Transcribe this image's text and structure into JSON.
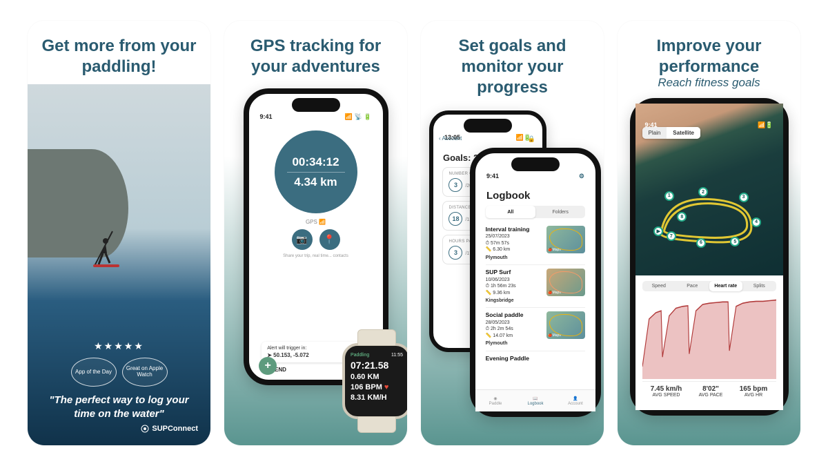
{
  "panel1": {
    "headline": "Get more from your paddling!",
    "stars": "★★★★★",
    "badge1": "App of the Day",
    "badge2": "Great on Apple Watch",
    "quote": "\"The perfect way to log your time on the water\"",
    "attribution": "SUPConnect"
  },
  "panel2": {
    "headline": "GPS tracking for your adventures",
    "status_time": "9:41",
    "status_right": "📶 📡 🔋",
    "timer": "00:34:12",
    "distance": "4.34 km",
    "gps_label": "GPS 📶",
    "share_hint": "Share your trip, real time... contacts",
    "alert_label": "Alert will trigger in:",
    "alert_coords": "➤ 50.153, -5.072",
    "extend": "EXTEND",
    "watch": {
      "activity": "Paddling",
      "clock": "11:55",
      "elapsed": "07:21.58",
      "dist": "0.60 KM",
      "hr": "106 BPM",
      "speed": "8.31 KM/H"
    }
  },
  "panel3": {
    "headline": "Set goals and monitor your progress",
    "goals": {
      "status_time": "13:05",
      "back": "‹ Account",
      "title": "Goals: 2024",
      "cards": [
        {
          "label": "NUMBER OF SESSIONS",
          "value": "3",
          "target": "/200"
        },
        {
          "label": "DISTANCE PADDLED",
          "value": "18",
          "target": "/1,000 KM"
        },
        {
          "label": "HOURS PADDLED",
          "value": "3",
          "target": "/175 HRS"
        }
      ]
    },
    "logbook": {
      "status_time": "9:41",
      "title": "Logbook",
      "tabs": [
        "All",
        "Folders"
      ],
      "items": [
        {
          "title": "Interval training",
          "date": "25/07/2023",
          "dur": "57m 57s",
          "dist": "6.30 km",
          "loc": "Plymouth",
          "map": "Maps"
        },
        {
          "title": "SUP Surf",
          "date": "10/06/2023",
          "dur": "1h 56m 23s",
          "dist": "9.36 km",
          "loc": "Kingsbridge",
          "map": "Maps"
        },
        {
          "title": "Social paddle",
          "date": "28/05/2023",
          "dur": "2h 2m 54s",
          "dist": "14.07 km",
          "loc": "Plymouth",
          "map": "Maps"
        },
        {
          "title": "Evening Paddle",
          "date": "",
          "dur": "",
          "dist": "",
          "loc": "",
          "map": ""
        }
      ],
      "nav": [
        "Paddle",
        "Logbook",
        "Account"
      ]
    }
  },
  "panel4": {
    "headline": "Improve your performance",
    "subhead": "Reach fitness goals",
    "status_time": "9:41",
    "map_modes": [
      "Plain",
      "Satellite"
    ],
    "waypoints": [
      "1",
      "2",
      "3",
      "4",
      "5",
      "6",
      "7",
      "8"
    ],
    "chart_tabs": [
      "Speed",
      "Pace",
      "Heart rate",
      "Splits"
    ],
    "stats": [
      {
        "v": "7.45 km/h",
        "l": "AVG SPEED"
      },
      {
        "v": "8'02\"",
        "l": "AVG PACE"
      },
      {
        "v": "165 bpm",
        "l": "AVG HR"
      }
    ]
  },
  "chart_data": {
    "type": "line",
    "title": "Heart rate",
    "ylabel": "bpm",
    "ylim": [
      60,
      190
    ],
    "x": [
      0,
      0.05,
      0.1,
      0.14,
      0.15,
      0.2,
      0.25,
      0.3,
      0.34,
      0.35,
      0.4,
      0.45,
      0.5,
      0.55,
      0.6,
      0.64,
      0.65,
      0.7,
      0.75,
      0.8,
      0.85,
      0.9,
      0.95,
      1.0
    ],
    "values": [
      80,
      155,
      165,
      168,
      95,
      160,
      172,
      175,
      176,
      100,
      168,
      178,
      180,
      181,
      182,
      182,
      105,
      175,
      180,
      182,
      183,
      183,
      184,
      185
    ]
  }
}
